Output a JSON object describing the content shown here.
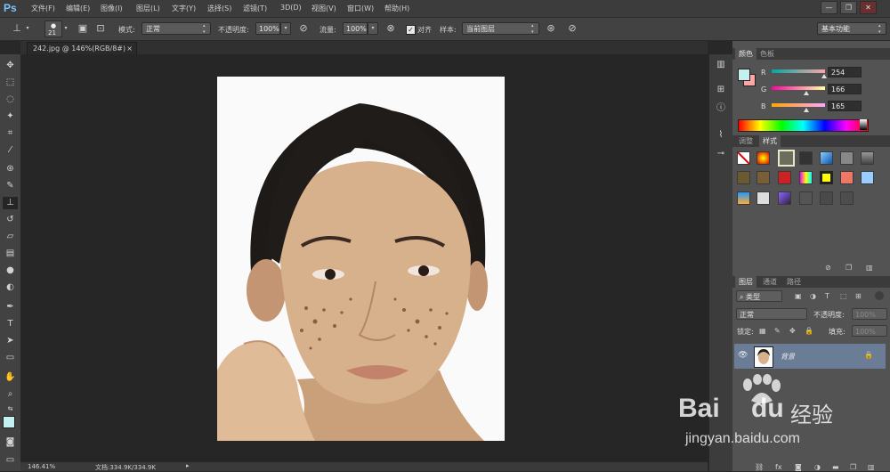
{
  "app": {
    "logo": "Ps"
  },
  "menu": [
    "文件(F)",
    "编辑(E)",
    "图像(I)",
    "图层(L)",
    "文字(Y)",
    "选择(S)",
    "滤镜(T)",
    "3D(D)",
    "视图(V)",
    "窗口(W)",
    "帮助(H)"
  ],
  "window_controls": {
    "minimize": "—",
    "restore": "❐",
    "close": "✕"
  },
  "options": {
    "brush_size": "21",
    "mode_label": "模式:",
    "mode_value": "正常",
    "opacity_label": "不透明度:",
    "opacity_value": "100%",
    "flow_label": "流量:",
    "flow_value": "100%",
    "align_label": "对齐",
    "sample_label": "样本:",
    "sample_value": "当前图层",
    "workspace": "基本功能"
  },
  "document_tab": {
    "title": "242.jpg @ 146%(RGB/8#)",
    "close": "×"
  },
  "status": {
    "zoom": "146.41%",
    "doc": "文档:334.9K/334.9K"
  },
  "color_panel": {
    "tabs": [
      "颜色",
      "色板"
    ],
    "r_label": "R",
    "g_label": "G",
    "b_label": "B",
    "r": "254",
    "g": "166",
    "b": "165",
    "fg_color": "#c4f0f0",
    "bg_color": "#fea6a5"
  },
  "styles_panel": {
    "tabs": [
      "调整",
      "样式"
    ]
  },
  "layers_panel": {
    "tabs": [
      "图层",
      "通道",
      "路径"
    ],
    "kind_label": "类型",
    "blend_mode": "正常",
    "opacity_label": "不透明度:",
    "opacity_value": "100%",
    "lock_label": "锁定:",
    "fill_label": "填充:",
    "fill_value": "100%",
    "layer_name": "背景"
  },
  "watermark": {
    "brand": "Bai",
    "brand2": "du",
    "cn": "经验",
    "url": "jingyan.baidu.com"
  }
}
